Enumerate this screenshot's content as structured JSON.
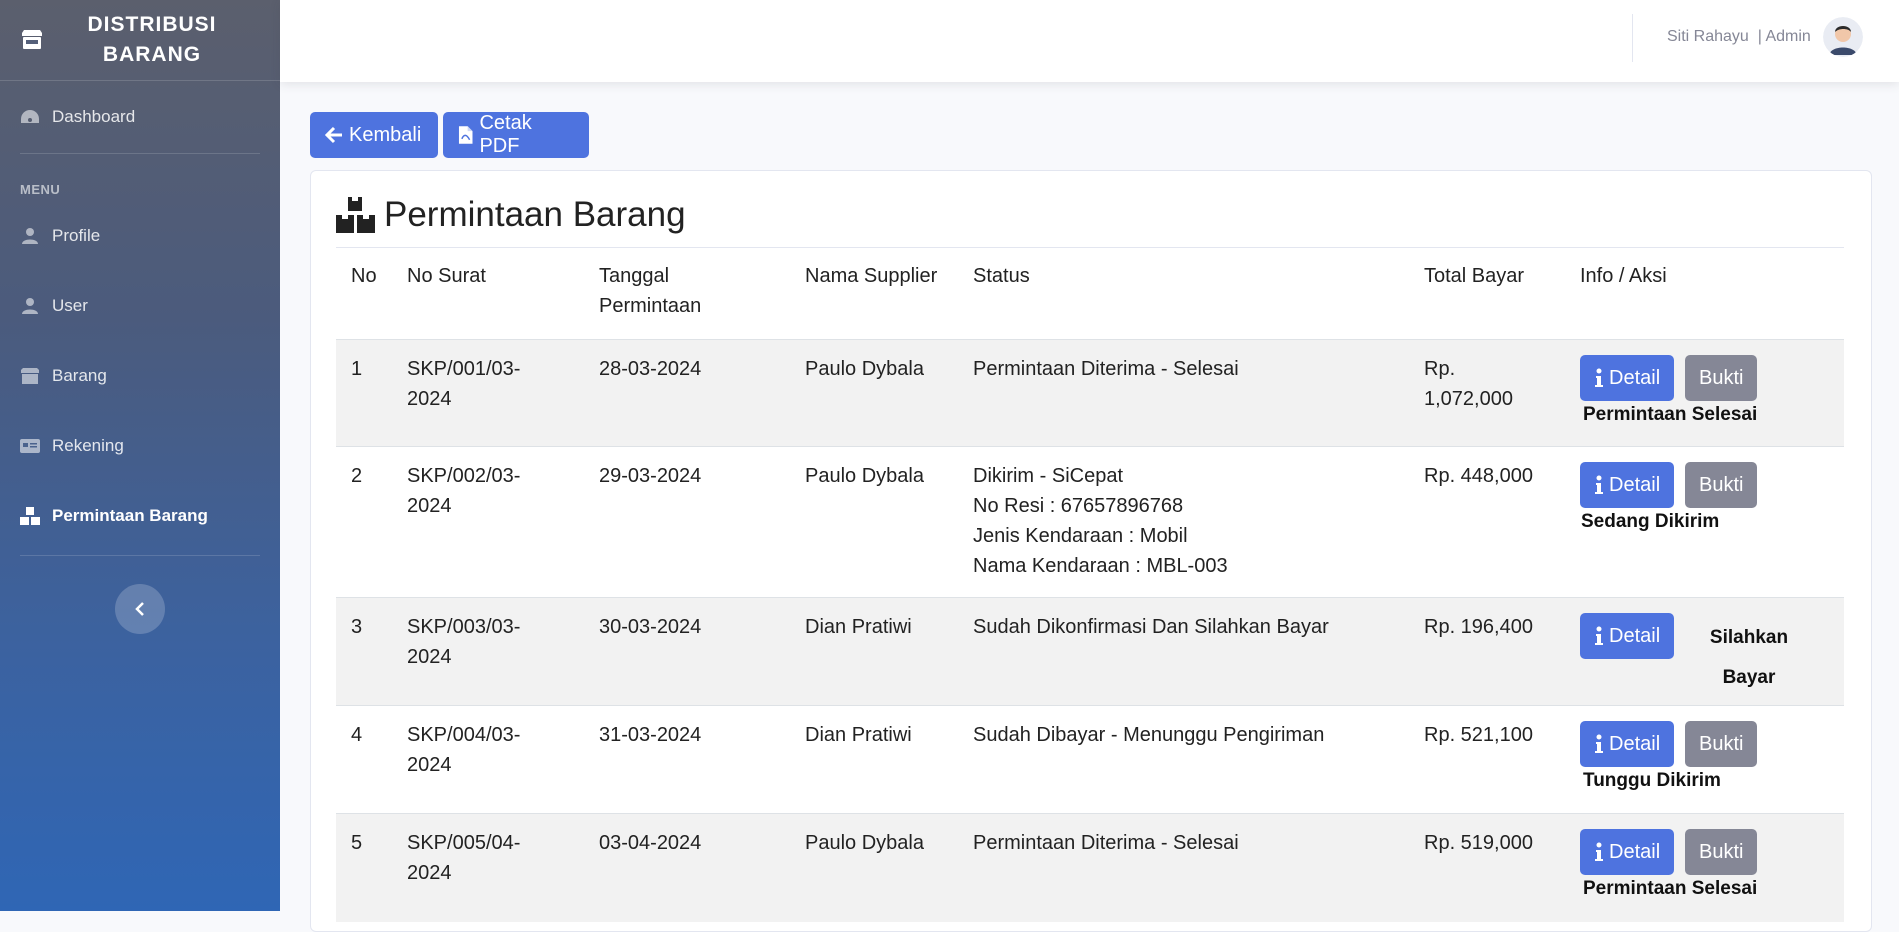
{
  "sidebar": {
    "brand": "DISTRIBUSI BARANG",
    "dashboard": "Dashboard",
    "menu_heading": "MENU",
    "items": [
      {
        "label": "Profile",
        "icon": "user-icon"
      },
      {
        "label": "User",
        "icon": "user-icon"
      },
      {
        "label": "Barang",
        "icon": "box-icon"
      },
      {
        "label": "Rekening",
        "icon": "card-icon"
      },
      {
        "label": "Permintaan Barang",
        "icon": "boxes-icon",
        "active": true
      }
    ]
  },
  "topbar": {
    "user": "Siti Rahayu",
    "role": "| Admin"
  },
  "actions": {
    "back": "Kembali",
    "pdf": "Cetak PDF"
  },
  "page": {
    "title": "Permintaan Barang"
  },
  "table": {
    "headers": [
      "No",
      "No Surat",
      "Tanggal Permintaan",
      "Nama Supplier",
      "Status",
      "Total Bayar",
      "Info / Aksi"
    ],
    "rows": [
      {
        "no": "1",
        "surat": "SKP/001/03-2024",
        "tanggal": "28-03-2024",
        "supplier": "Paulo Dybala",
        "status": [
          "Permintaan Diterima - Selesai"
        ],
        "total": "Rp. 1,072,000",
        "detail": "Detail",
        "bukti": "Bukti",
        "aksi": "Permintaan Selesai"
      },
      {
        "no": "2",
        "surat": "SKP/002/03-2024",
        "tanggal": "29-03-2024",
        "supplier": "Paulo Dybala",
        "status": [
          "Dikirim - SiCepat",
          "No Resi : 67657896768",
          "Jenis Kendaraan : Mobil",
          "Nama Kendaraan : MBL-003"
        ],
        "total": "Rp. 448,000",
        "detail": "Detail",
        "bukti": "Bukti",
        "aksi": "Sedang Dikirim"
      },
      {
        "no": "3",
        "surat": "SKP/003/03-2024",
        "tanggal": "30-03-2024",
        "supplier": "Dian Pratiwi",
        "status": [
          "Sudah Dikonfirmasi Dan Silahkan Bayar"
        ],
        "total": "Rp. 196,400",
        "detail": "Detail",
        "bukti": "",
        "aksi": "Silahkan Bayar"
      },
      {
        "no": "4",
        "surat": "SKP/004/03-2024",
        "tanggal": "31-03-2024",
        "supplier": "Dian Pratiwi",
        "status": [
          "Sudah Dibayar - Menunggu Pengiriman"
        ],
        "total": "Rp. 521,100",
        "detail": "Detail",
        "bukti": "Bukti",
        "aksi": "Tunggu Dikirim"
      },
      {
        "no": "5",
        "surat": "SKP/005/04-2024",
        "tanggal": "03-04-2024",
        "supplier": "Paulo Dybala",
        "status": [
          "Permintaan Diterima - Selesai"
        ],
        "total": "Rp. 519,000",
        "detail": "Detail",
        "bukti": "Bukti",
        "aksi": "Permintaan Selesai"
      }
    ]
  }
}
